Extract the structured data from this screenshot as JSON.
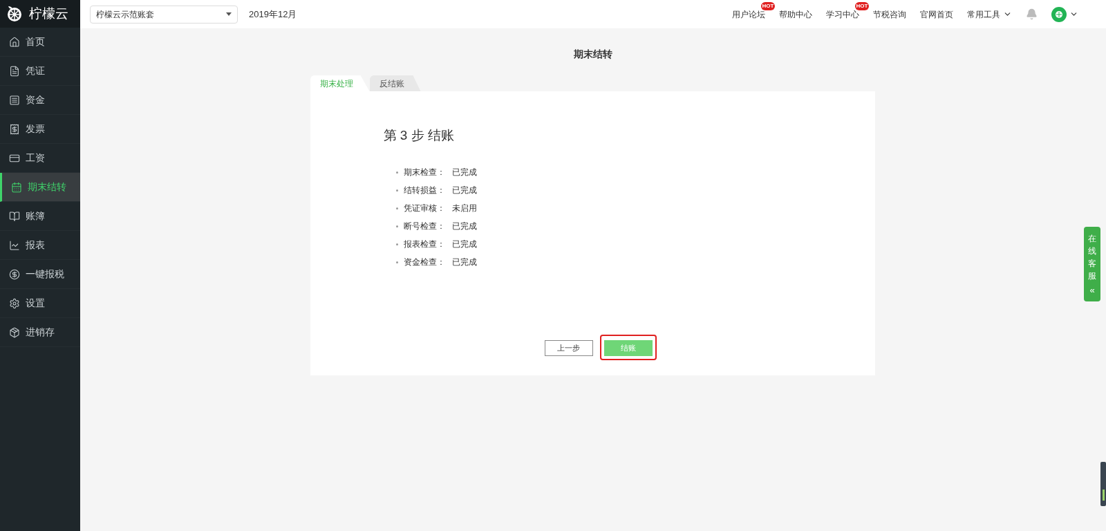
{
  "brand": "柠檬云",
  "sidebar": {
    "items": [
      {
        "label": "首页",
        "selected": false
      },
      {
        "label": "凭证",
        "selected": false
      },
      {
        "label": "资金",
        "selected": false
      },
      {
        "label": "发票",
        "selected": false
      },
      {
        "label": "工资",
        "selected": false
      },
      {
        "label": "期末结转",
        "selected": true
      },
      {
        "label": "账簿",
        "selected": false
      },
      {
        "label": "报表",
        "selected": false
      },
      {
        "label": "一键报税",
        "selected": false
      },
      {
        "label": "设置",
        "selected": false
      },
      {
        "label": "进销存",
        "selected": false
      }
    ]
  },
  "topbar": {
    "account_select": "柠檬云示范账套",
    "period": "2019年12月",
    "links": [
      {
        "label": "用户论坛",
        "badge": "HOT"
      },
      {
        "label": "帮助中心"
      },
      {
        "label": "学习中心",
        "badge": "HOT"
      },
      {
        "label": "节税咨询"
      },
      {
        "label": "官网首页"
      },
      {
        "label": "常用工具",
        "dropdown": true
      }
    ]
  },
  "page_title": "期末结转",
  "tabs": [
    {
      "label": "期末处理",
      "selected": true
    },
    {
      "label": "反结账",
      "selected": false
    }
  ],
  "step_title": "第 3 步 结账",
  "checks": [
    {
      "name": "期末检查：",
      "status": "已完成"
    },
    {
      "name": "结转损益：",
      "status": "已完成"
    },
    {
      "name": "凭证审核：",
      "status": "未启用"
    },
    {
      "name": "断号检查：",
      "status": "已完成"
    },
    {
      "name": "报表检查：",
      "status": "已完成"
    },
    {
      "name": "资金检查：",
      "status": "已完成"
    }
  ],
  "buttons": [
    {
      "label": "上一步",
      "kind": "secondary",
      "highlighted": false
    },
    {
      "label": "结账",
      "kind": "primary",
      "highlighted": true
    }
  ],
  "service_tab": {
    "label": "在线客服",
    "arrow": "«"
  }
}
